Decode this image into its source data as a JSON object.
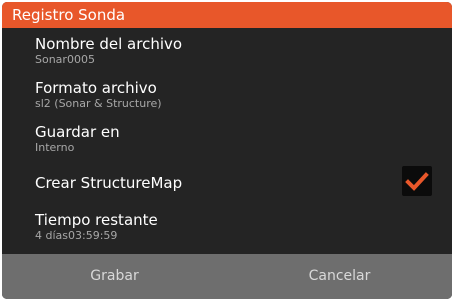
{
  "dialog": {
    "title": "Registro Sonda",
    "items": [
      {
        "label": "Nombre del archivo",
        "value": "Sonar0005"
      },
      {
        "label": "Formato archivo",
        "value": "sl2 (Sonar & Structure)"
      },
      {
        "label": "Guardar en",
        "value": "Interno"
      },
      {
        "label": "Crear StructureMap",
        "checked": true
      },
      {
        "label": "Tiempo restante",
        "value": "4 días03:59:59"
      }
    ],
    "buttons": {
      "record": "Grabar",
      "cancel": "Cancelar"
    }
  },
  "colors": {
    "accent": "#e8572a",
    "background": "#242424",
    "footer": "#6e6e6e"
  },
  "icons": {
    "check": "checkmark-icon"
  }
}
